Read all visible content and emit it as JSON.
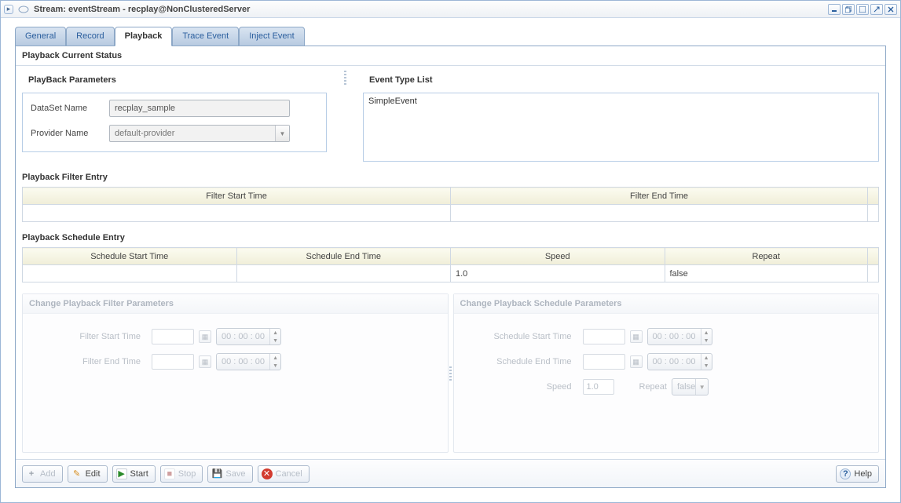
{
  "window": {
    "title": "Stream: eventStream - recplay@NonClusteredServer"
  },
  "tabs": {
    "general": "General",
    "record": "Record",
    "playback": "Playback",
    "trace": "Trace Event",
    "inject": "Inject Event"
  },
  "status": {
    "title": "Playback Current Status",
    "params_title": "PlayBack Parameters",
    "events_title": "Event Type List",
    "dataset_label": "DataSet Name",
    "dataset_value": "recplay_sample",
    "provider_label": "Provider Name",
    "provider_value": "default-provider",
    "event_types": [
      "SimpleEvent"
    ]
  },
  "filter": {
    "title": "Playback Filter Entry",
    "col_start": "Filter Start Time",
    "col_end": "Filter End Time",
    "rows": [
      {
        "start": "",
        "end": ""
      }
    ]
  },
  "schedule": {
    "title": "Playback Schedule Entry",
    "col_start": "Schedule Start Time",
    "col_end": "Schedule End Time",
    "col_speed": "Speed",
    "col_repeat": "Repeat",
    "rows": [
      {
        "start": "",
        "end": "",
        "speed": "1.0",
        "repeat": "false"
      }
    ]
  },
  "change_filter": {
    "title": "Change Playback Filter Parameters",
    "start_label": "Filter Start Time",
    "end_label": "Filter End Time",
    "time_value": "00 : 00 : 00"
  },
  "change_schedule": {
    "title": "Change Playback Schedule Parameters",
    "start_label": "Schedule Start Time",
    "end_label": "Schedule End Time",
    "time_value": "00 : 00 : 00",
    "speed_label": "Speed",
    "speed_value": "1.0",
    "repeat_label": "Repeat",
    "repeat_value": "false"
  },
  "toolbar": {
    "add": "Add",
    "edit": "Edit",
    "start": "Start",
    "stop": "Stop",
    "save": "Save",
    "cancel": "Cancel",
    "help": "Help"
  }
}
